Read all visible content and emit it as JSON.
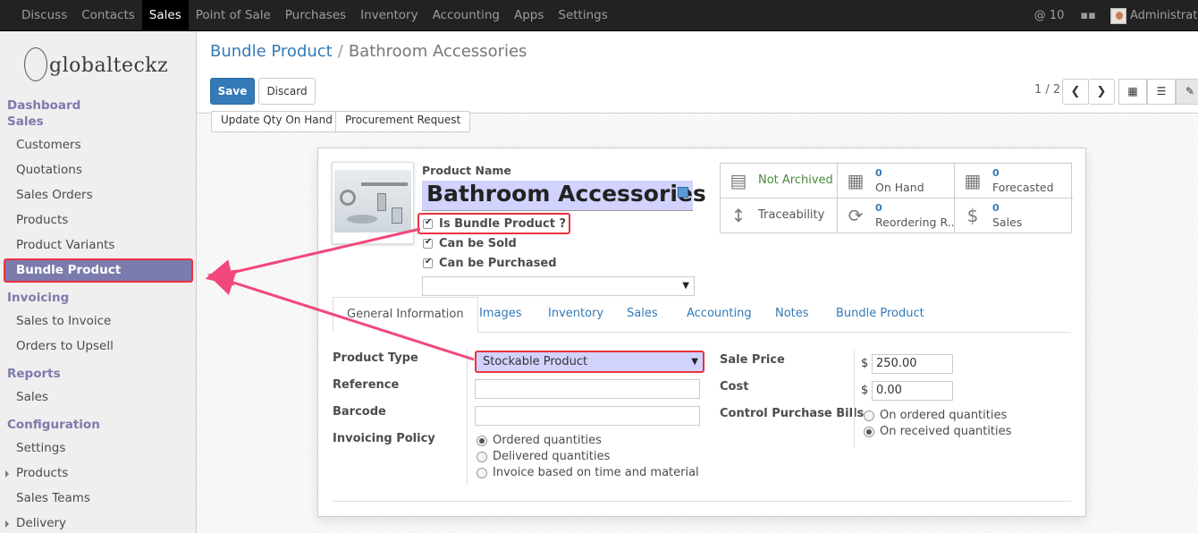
{
  "topbar": {
    "menu": [
      "Discuss",
      "Contacts",
      "Sales",
      "Point of Sale",
      "Purchases",
      "Inventory",
      "Accounting",
      "Apps",
      "Settings"
    ],
    "active": "Sales",
    "mentions": "@ 10",
    "user": "Administrator"
  },
  "sidebar": {
    "logo": "globalteckz",
    "dashboard": "Dashboard",
    "sales_head": "Sales",
    "sales_items": [
      "Customers",
      "Quotations",
      "Sales Orders",
      "Products",
      "Product Variants",
      "Bundle Product"
    ],
    "invoicing_head": "Invoicing",
    "invoicing_items": [
      "Sales to Invoice",
      "Orders to Upsell"
    ],
    "reports_head": "Reports",
    "reports_items": [
      "Sales"
    ],
    "config_head": "Configuration",
    "config_items": [
      "Settings",
      "Products",
      "Sales Teams",
      "Delivery"
    ]
  },
  "control": {
    "breadcrumb_parent": "Bundle Product",
    "breadcrumb_sep": "/",
    "breadcrumb_current": "Bathroom Accessories",
    "save": "Save",
    "discard": "Discard",
    "pager": "1 / 2"
  },
  "header_buttons": [
    "Update Qty On Hand",
    "Procurement Request"
  ],
  "product": {
    "name_label": "Product Name",
    "name": "Bathroom Accessories",
    "is_bundle_label": "Is Bundle Product ?",
    "can_be_sold_label": "Can be Sold",
    "can_be_purchased_label": "Can be Purchased"
  },
  "stats": [
    {
      "num": "",
      "label": "Not Archived"
    },
    {
      "num": "0",
      "label": "On Hand"
    },
    {
      "num": "0",
      "label": "Forecasted"
    },
    {
      "num": "",
      "label": "Traceability"
    },
    {
      "num": "0",
      "label": "Reordering R..."
    },
    {
      "num": "0",
      "label": "Sales"
    }
  ],
  "tabs": [
    "General Information",
    "Images",
    "Inventory",
    "Sales",
    "Accounting",
    "Notes",
    "Bundle Product"
  ],
  "general": {
    "product_type_label": "Product Type",
    "product_type": "Stockable Product",
    "reference_label": "Reference",
    "barcode_label": "Barcode",
    "invoicing_policy_label": "Invoicing Policy",
    "invoicing_options": [
      "Ordered quantities",
      "Delivered quantities",
      "Invoice based on time and material"
    ],
    "sale_price_label": "Sale Price",
    "sale_price": "250.00",
    "cost_label": "Cost",
    "cost": "0.00",
    "currency": "$",
    "control_bills_label": "Control Purchase Bills",
    "control_options": [
      "On ordered quantities",
      "On received quantities"
    ]
  },
  "colors": {
    "topbar": "#222222",
    "sidebar_accent": "#7c7bad",
    "primary": "#337ab7",
    "highlight": "#e8333e",
    "field_required": "#d2d2ff"
  }
}
